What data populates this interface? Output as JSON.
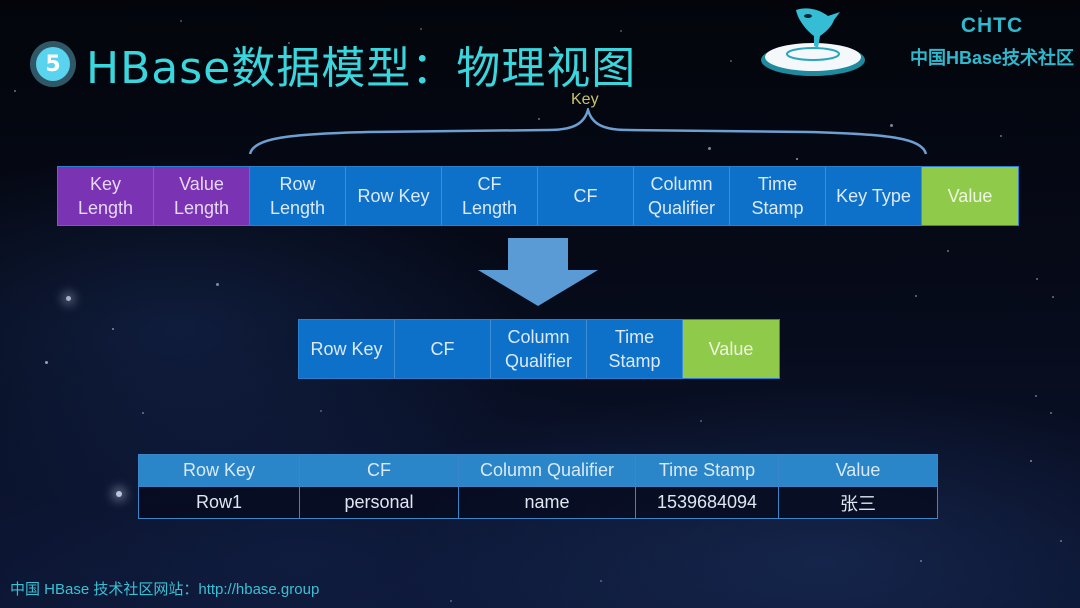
{
  "slide": {
    "badge_number": "5",
    "title": "HBase数据模型：物理视图"
  },
  "brand": {
    "title": "CHTC",
    "subtitle": "中国HBase技术社区",
    "logo_icon": "orca-whale-logo"
  },
  "key_brace": {
    "label": "Key"
  },
  "key_value_layout": {
    "cells": [
      {
        "label": "Key\nLength",
        "group": "length"
      },
      {
        "label": "Value\nLength",
        "group": "length"
      },
      {
        "label": "Row\nLength",
        "group": "key"
      },
      {
        "label": "Row Key",
        "group": "key"
      },
      {
        "label": "CF\nLength",
        "group": "key"
      },
      {
        "label": "CF",
        "group": "key"
      },
      {
        "label": "Column\nQualifier",
        "group": "key"
      },
      {
        "label": "Time\nStamp",
        "group": "key"
      },
      {
        "label": "Key Type",
        "group": "key"
      },
      {
        "label": "Value",
        "group": "value"
      }
    ]
  },
  "simplified_layout": {
    "cells": [
      {
        "label": "Row Key",
        "group": "key"
      },
      {
        "label": "CF",
        "group": "key"
      },
      {
        "label": "Column\nQualifier",
        "group": "key"
      },
      {
        "label": "Time\nStamp",
        "group": "key"
      },
      {
        "label": "Value",
        "group": "value"
      }
    ]
  },
  "example_table": {
    "headers": [
      "Row Key",
      "CF",
      "Column Qualifier",
      "Time Stamp",
      "Value"
    ],
    "rows": [
      [
        "Row1",
        "personal",
        "name",
        "1539684094",
        "张三"
      ]
    ]
  },
  "colors": {
    "title": "#3ad6de",
    "length_group": "#7a34b3",
    "key_group": "#0e71c9",
    "value_group": "#8fca4a",
    "arrow": "#5b9bd5",
    "table_header": "#2a86c8"
  },
  "footer": {
    "text": "中国 HBase 技术社区网站：http://hbase.group"
  }
}
